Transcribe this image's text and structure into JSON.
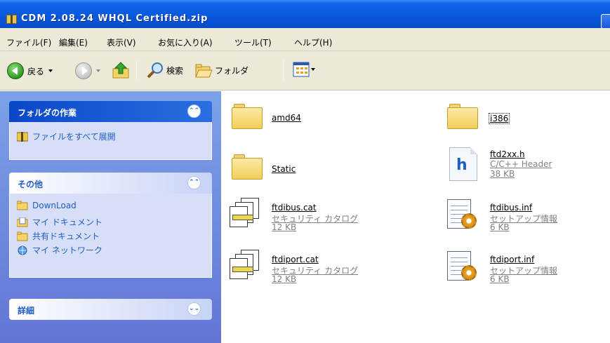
{
  "window": {
    "title": "CDM 2.08.24 WHQL Certified.zip"
  },
  "menu": {
    "items": [
      "ファイル(F)",
      "編集(E)",
      "表示(V)",
      "お気に入り(A)",
      "ツール(T)",
      "ヘルプ(H)"
    ]
  },
  "toolbar": {
    "back_label": "戻る",
    "search_label": "検索",
    "folders_label": "フォルダ"
  },
  "taskpane": {
    "folder_tasks": {
      "title": "フォルダの作業",
      "items": [
        "ファイルをすべて展開"
      ]
    },
    "other_places": {
      "title": "その他",
      "items": [
        "DownLoad",
        "マイ ドキュメント",
        "共有ドキュメント",
        "マイ ネットワーク"
      ]
    },
    "details": {
      "title": "詳細"
    }
  },
  "files": [
    {
      "name": "amd64",
      "icon": "folder-icon"
    },
    {
      "name": "i386",
      "icon": "folder-icon"
    },
    {
      "name": "Static",
      "icon": "folder-icon"
    },
    {
      "name": "ftd2xx.h",
      "type": "C/C++ Header",
      "size": "38 KB",
      "icon": "header-file-icon"
    },
    {
      "name": "ftdibus.cat",
      "type": "セキュリティ カタログ",
      "size": "12 KB",
      "icon": "security-catalog-icon"
    },
    {
      "name": "ftdibus.inf",
      "type": "セットアップ情報",
      "size": "6 KB",
      "icon": "setup-info-icon"
    },
    {
      "name": "ftdiport.cat",
      "type": "セキュリティ カタログ",
      "size": "12 KB",
      "icon": "security-catalog-icon"
    },
    {
      "name": "ftdiport.inf",
      "type": "セットアップ情報",
      "size": "6 KB",
      "icon": "setup-info-icon"
    }
  ],
  "colors": {
    "titlebar": "#0a5ae0",
    "taskpane_bg": "#7ba2e7",
    "panel_link": "#215dc6"
  }
}
